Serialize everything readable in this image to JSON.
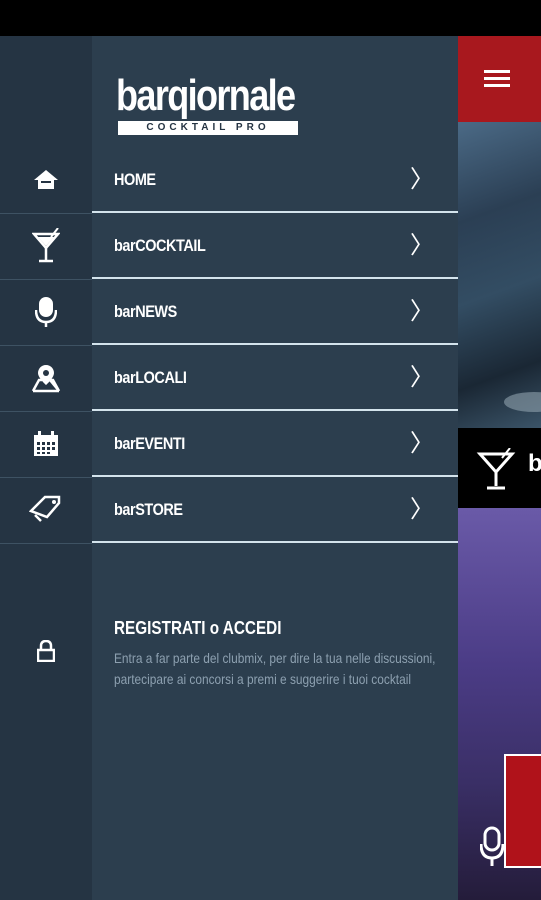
{
  "app": {
    "logo_main": "barqiornale",
    "logo_sub": "COCKTAIL PRO"
  },
  "menu": [
    {
      "label": "HOME",
      "icon": "home-icon"
    },
    {
      "label": "barCOCKTAIL",
      "icon": "cocktail-icon"
    },
    {
      "label": "barNEWS",
      "icon": "microphone-icon"
    },
    {
      "label": "barLOCALI",
      "icon": "location-map-icon"
    },
    {
      "label": "barEVENTI",
      "icon": "calendar-icon"
    },
    {
      "label": "barSTORE",
      "icon": "tag-icon"
    }
  ],
  "chevron": "〉",
  "register": {
    "title": "REGISTRATI o ACCEDI",
    "description": "Entra a far parte del clubmix, per dire la tua nelle discussioni, partecipare ai concorsi a premi e suggerire i tuoi cocktail",
    "icon": "lock-icon"
  },
  "background_app": {
    "category_text": "b"
  },
  "colors": {
    "drawer": "#2c3e4e",
    "icon_column": "#253443",
    "accent_red": "#a8181e",
    "separator": "#d4e3ec",
    "muted_text": "#8da0b0"
  }
}
